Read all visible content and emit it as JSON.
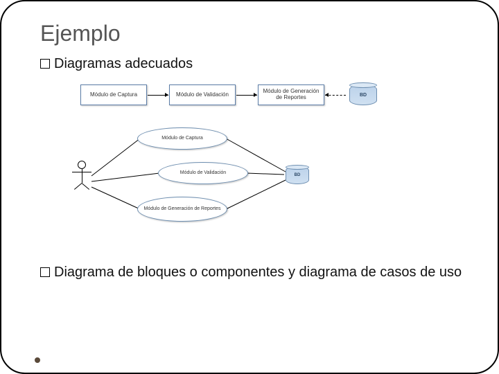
{
  "title": "Ejemplo",
  "bullets": {
    "b1": "Diagramas adecuados",
    "b2": "Diagrama de bloques o componentes y diagrama de casos de uso"
  },
  "flow": {
    "box1": "Módulo de Captura",
    "box2": "Módulo de Validación",
    "box3": "Módulo de Generación de Reportes",
    "db": "BD"
  },
  "usecase": {
    "e1": "Módulo de Captura",
    "e2": "Módulo de Validación",
    "e3": "Módulo de Generación de Reportes",
    "db": "BD"
  }
}
